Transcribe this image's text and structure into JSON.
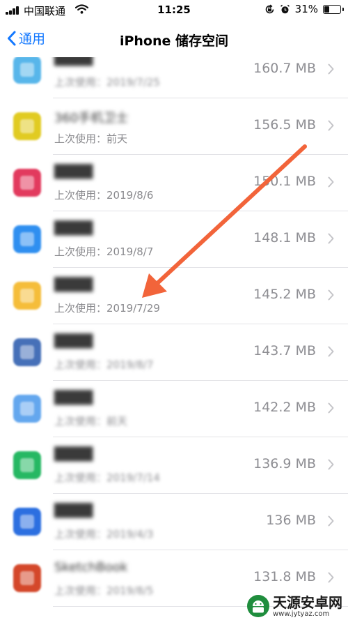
{
  "status_bar": {
    "carrier": "中国联通",
    "time": "11:25",
    "battery": "31%",
    "battery_level": 0.31
  },
  "nav": {
    "back_label": "通用",
    "title": "iPhone 储存空间"
  },
  "apps": [
    {
      "name": "████",
      "last_used": "上次使用：2019/7/25",
      "size": "160.7 MB",
      "color": "#58b6ea",
      "used_blurred": true
    },
    {
      "name": "360手机卫士",
      "last_used": "上次使用：前天",
      "size": "156.5 MB",
      "color": "#e1cb22",
      "used_blurred": false
    },
    {
      "name": "████",
      "last_used": "上次使用：2019/8/6",
      "size": "150.1 MB",
      "color": "#e23a5e",
      "used_blurred": false
    },
    {
      "name": "████",
      "last_used": "上次使用：2019/8/7",
      "size": "148.1 MB",
      "color": "#2f8ff0",
      "used_blurred": false
    },
    {
      "name": "████",
      "last_used": "上次使用：2019/7/29",
      "size": "145.2 MB",
      "color": "#f5bd3a",
      "used_blurred": false
    },
    {
      "name": "████",
      "last_used": "上次使用：2019/8/7",
      "size": "143.7 MB",
      "color": "#4670b8",
      "used_blurred": true
    },
    {
      "name": "████",
      "last_used": "上次使用：前天",
      "size": "142.2 MB",
      "color": "#64a7ee",
      "used_blurred": true
    },
    {
      "name": "████",
      "last_used": "上次使用：2019/7/14",
      "size": "136.9 MB",
      "color": "#26b863",
      "used_blurred": true
    },
    {
      "name": "████",
      "last_used": "上次使用：2019/4/3",
      "size": "136 MB",
      "color": "#2c6fe0",
      "used_blurred": true
    },
    {
      "name": "SketchBook",
      "last_used": "上次使用：2019/8/5",
      "size": "131.8 MB",
      "color": "#d4472a",
      "used_blurred": true
    }
  ],
  "watermark": {
    "text": "天源安卓网",
    "url": "www.jytyaz.com"
  },
  "colors": {
    "accent": "#1378ff",
    "annotation_arrow": "#f2643a"
  }
}
